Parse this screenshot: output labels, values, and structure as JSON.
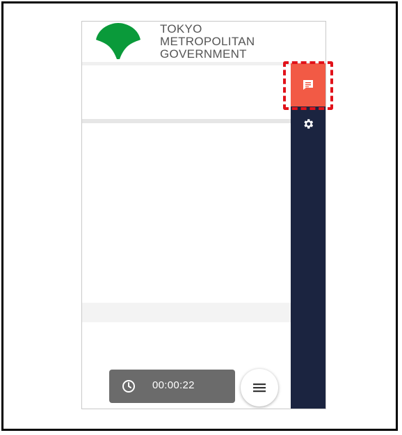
{
  "brand": {
    "line1": "TOKYO",
    "line2": "METROPOLITAN",
    "line3": "GOVERNMENT"
  },
  "timer": {
    "elapsed": "00:00:22"
  },
  "icons": {
    "logo": "ginkgo-leaf-icon",
    "chat": "chat-icon",
    "settings": "gear-icon",
    "clock": "clock-icon",
    "menu": "hamburger-menu-icon"
  },
  "colors": {
    "logo_green": "#0a9a3a",
    "chat_accent": "#f25a45",
    "rail_navy": "#1b2440",
    "timer_bg": "#6b6b6b",
    "highlight": "#e1121a"
  }
}
